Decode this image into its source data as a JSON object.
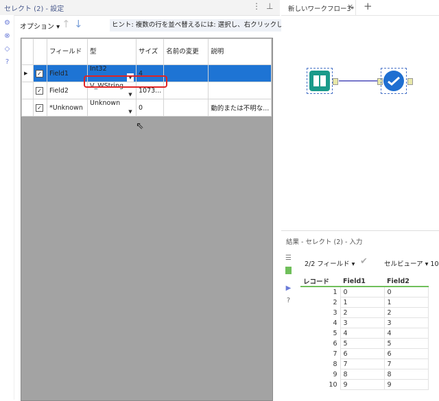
{
  "config": {
    "title": "セレクト (2) - 設定",
    "options_label": "オプション ▾",
    "hint": "ヒント: 複数の行を並べ替えるには: 選択し、右クリックして!",
    "columns": [
      "フィールド",
      "型",
      "サイズ",
      "名前の変更",
      "説明"
    ],
    "rows": [
      {
        "selected": true,
        "checked": true,
        "field": "Field1",
        "type": "Int32",
        "size": "4",
        "rename": "",
        "desc": ""
      },
      {
        "selected": false,
        "checked": true,
        "field": "Field2",
        "type": "V_WString",
        "size": "1073...",
        "rename": "",
        "desc": ""
      },
      {
        "selected": false,
        "checked": true,
        "field": "*Unknown",
        "type": "Unknown",
        "size": "0",
        "rename": "",
        "desc": "動的または不明な..."
      }
    ]
  },
  "tabs": {
    "workflow_label": "新しいワークフロー3*",
    "close": "×",
    "add": "+"
  },
  "results": {
    "title": "結果 - セレクト (2) - 入力",
    "field_count": "2/2 フィールド ▾",
    "cell_viewer": "セルビューア ▾ 10",
    "columns": [
      "レコード",
      "Field1",
      "Field2"
    ],
    "rows": [
      [
        "1",
        "0",
        "0"
      ],
      [
        "2",
        "1",
        "1"
      ],
      [
        "3",
        "2",
        "2"
      ],
      [
        "4",
        "3",
        "3"
      ],
      [
        "5",
        "4",
        "4"
      ],
      [
        "6",
        "5",
        "5"
      ],
      [
        "7",
        "6",
        "6"
      ],
      [
        "8",
        "7",
        "7"
      ],
      [
        "9",
        "8",
        "8"
      ],
      [
        "10",
        "9",
        "9"
      ]
    ]
  },
  "colors": {
    "selection": "#1e74d4",
    "highlight": "#e02424",
    "accent": "#6a7bd8",
    "tool_input": "#1a9a8a",
    "tool_select": "#1f6fd1"
  }
}
